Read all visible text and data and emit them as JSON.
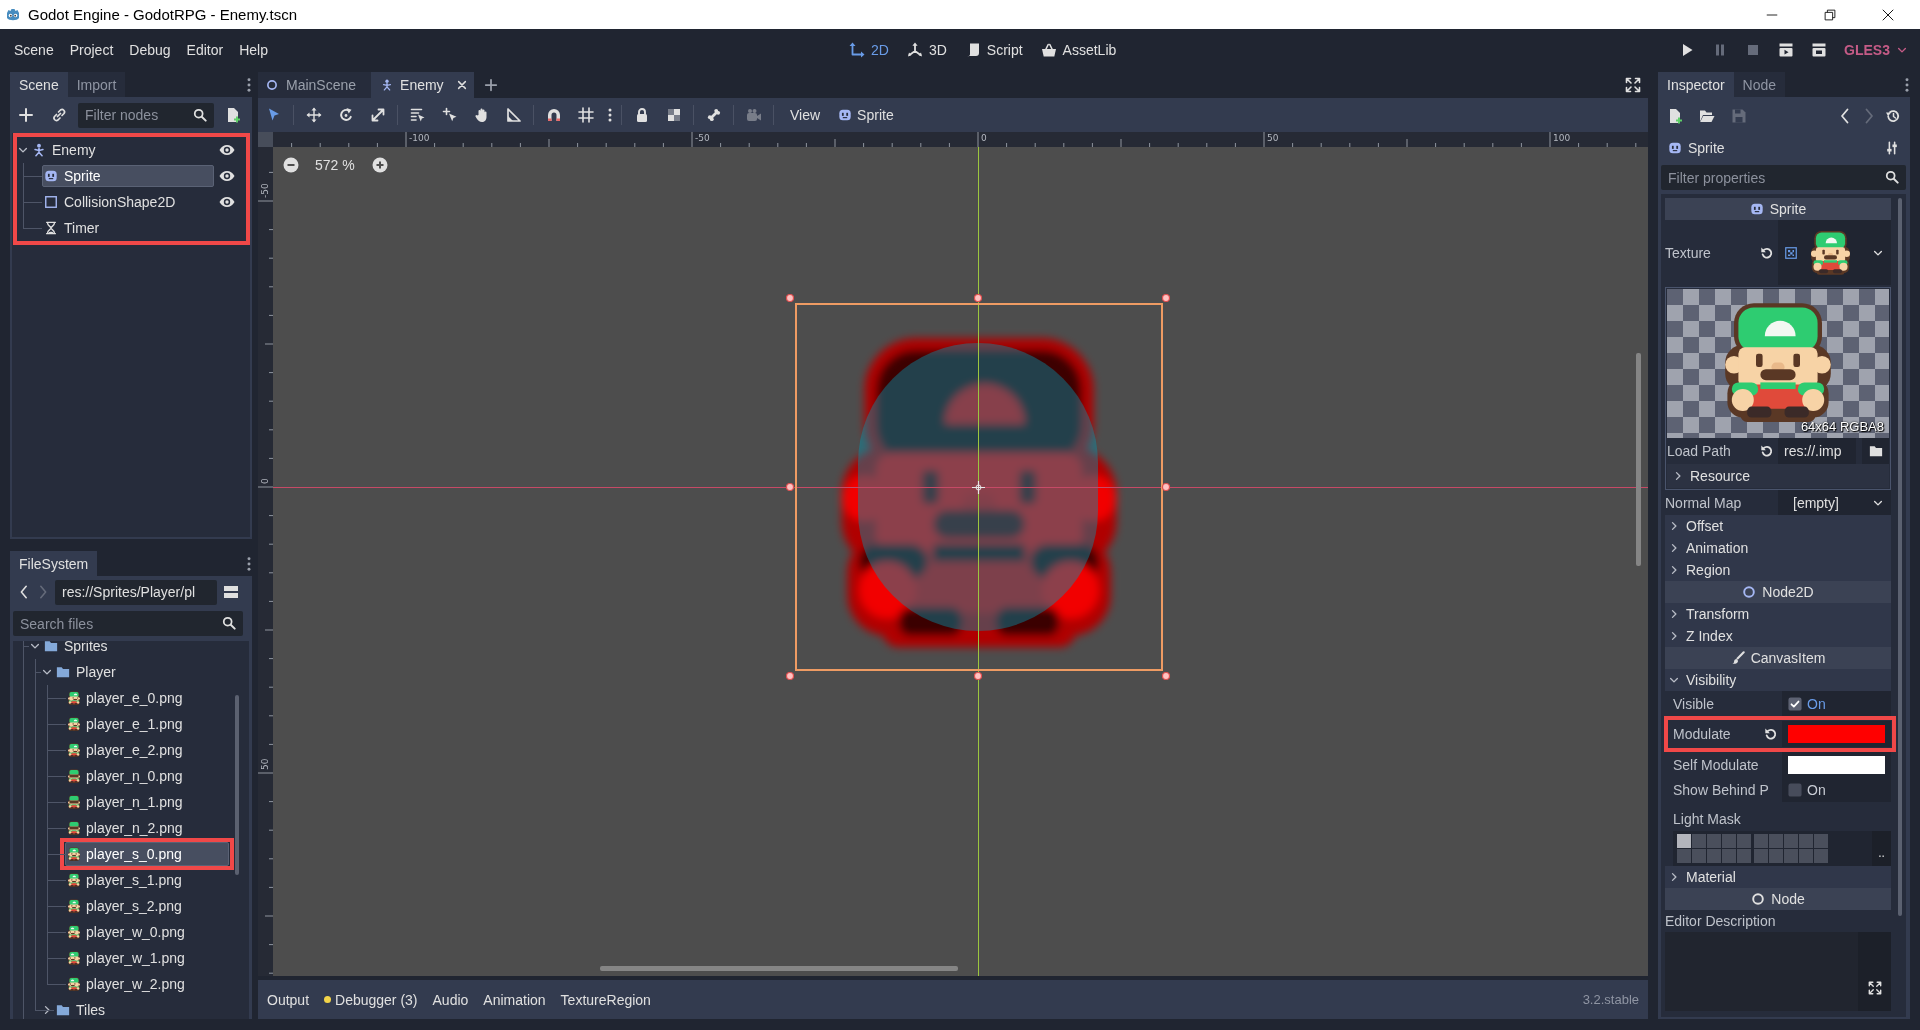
{
  "window": {
    "title": "Godot Engine - GodotRPG - Enemy.tscn"
  },
  "menu_bar": {
    "menus": [
      "Scene",
      "Project",
      "Debug",
      "Editor",
      "Help"
    ],
    "workspaces": [
      {
        "label": "2D",
        "kind": "canvas",
        "selected": true
      },
      {
        "label": "3D",
        "kind": "spatial",
        "selected": false
      },
      {
        "label": "Script",
        "kind": "script",
        "selected": false
      },
      {
        "label": "AssetLib",
        "kind": "assetlib",
        "selected": false
      }
    ],
    "run_buttons": [
      {
        "kind": "play",
        "disabled": false
      },
      {
        "kind": "pause",
        "disabled": true
      },
      {
        "kind": "stop",
        "disabled": true
      },
      {
        "kind": "play_scene",
        "disabled": false
      },
      {
        "kind": "play_custom",
        "disabled": false
      }
    ],
    "renderer": "GLES3"
  },
  "scene_dock": {
    "tabs": [
      {
        "label": "Scene",
        "selected": true
      },
      {
        "label": "Import",
        "selected": false
      }
    ],
    "filter": {
      "placeholder": "Filter nodes"
    },
    "highlighted": true,
    "tree": [
      {
        "name": "Enemy",
        "kind": "kinematic_body",
        "expanded": true,
        "selected": false,
        "visibility_toggle": true,
        "children": [
          {
            "name": "Sprite",
            "kind": "sprite",
            "selected": true,
            "visibility_toggle": true
          },
          {
            "name": "CollisionShape2D",
            "kind": "collision_shape",
            "selected": false,
            "visibility_toggle": true
          },
          {
            "name": "Timer",
            "kind": "timer",
            "selected": false,
            "visibility_toggle": false
          }
        ]
      }
    ]
  },
  "filesystem_dock": {
    "tabs": [
      {
        "label": "FileSystem",
        "selected": true
      }
    ],
    "nav": [
      {
        "kind": "back",
        "disabled": false
      },
      {
        "kind": "forward",
        "disabled": true
      }
    ],
    "path": "res://Sprites/Player/pl",
    "search": {
      "placeholder": "Search files"
    },
    "tree": [
      {
        "name": "Sprites",
        "kind": "folder",
        "expanded": true,
        "selected": false,
        "highlighted": false,
        "children": [
          {
            "name": "Player",
            "kind": "folder",
            "expanded": true,
            "selected": false,
            "highlighted": false,
            "children": [
              {
                "name": "player_e_0.png",
                "kind": "east",
                "selected": false,
                "highlighted": false
              },
              {
                "name": "player_e_1.png",
                "kind": "east",
                "selected": false,
                "highlighted": false
              },
              {
                "name": "player_e_2.png",
                "kind": "east",
                "selected": false,
                "highlighted": false
              },
              {
                "name": "player_n_0.png",
                "kind": "north",
                "selected": false,
                "highlighted": false
              },
              {
                "name": "player_n_1.png",
                "kind": "north",
                "selected": false,
                "highlighted": false
              },
              {
                "name": "player_n_2.png",
                "kind": "north",
                "selected": false,
                "highlighted": false
              },
              {
                "name": "player_s_0.png",
                "kind": "south",
                "selected": true,
                "highlighted": true
              },
              {
                "name": "player_s_1.png",
                "kind": "south",
                "selected": false,
                "highlighted": false
              },
              {
                "name": "player_s_2.png",
                "kind": "south",
                "selected": false,
                "highlighted": false
              },
              {
                "name": "player_w_0.png",
                "kind": "west",
                "selected": false,
                "highlighted": false
              },
              {
                "name": "player_w_1.png",
                "kind": "west",
                "selected": false,
                "highlighted": false
              },
              {
                "name": "player_w_2.png",
                "kind": "west",
                "selected": false,
                "highlighted": false
              }
            ]
          },
          {
            "name": "Tiles",
            "kind": "folder",
            "expanded": false,
            "selected": false,
            "highlighted": false
          }
        ]
      }
    ]
  },
  "editor": {
    "tabs": [
      {
        "label": "MainScene",
        "kind": "node2d",
        "selected": false,
        "closable": false
      },
      {
        "label": "Enemy",
        "kind": "kinematic_body",
        "selected": true,
        "closable": true
      }
    ],
    "toolbar": {
      "tool_groups": [
        [
          {
            "kind": "select",
            "selected": true,
            "disabled": false
          }
        ],
        [
          {
            "kind": "move",
            "selected": false,
            "disabled": false
          },
          {
            "kind": "rotate",
            "selected": false,
            "disabled": false
          },
          {
            "kind": "scale",
            "selected": false,
            "disabled": false
          }
        ],
        [
          {
            "kind": "list_select",
            "selected": false,
            "disabled": false
          },
          {
            "kind": "pivot",
            "selected": false,
            "disabled": false
          },
          {
            "kind": "pan",
            "selected": false,
            "disabled": false
          },
          {
            "kind": "ruler",
            "selected": false,
            "disabled": false
          }
        ],
        [
          {
            "kind": "smart_snap",
            "selected": false,
            "disabled": false
          },
          {
            "kind": "grid_snap",
            "selected": false,
            "disabled": false
          },
          {
            "kind": "more",
            "selected": false,
            "disabled": false
          }
        ],
        [
          {
            "kind": "lock",
            "selected": false,
            "disabled": false
          },
          {
            "kind": "group",
            "selected": false,
            "disabled": false
          }
        ],
        [
          {
            "kind": "bone",
            "selected": false,
            "disabled": false
          }
        ],
        [
          {
            "kind": "camera",
            "selected": false,
            "disabled": true
          }
        ]
      ],
      "menus": [
        {
          "label": "View",
          "kind": "plain"
        },
        {
          "label": "Sprite",
          "kind": "sprite"
        }
      ]
    },
    "zoom": "572 %",
    "rulers": {
      "horizontal": [
        "-100",
        "-50",
        "0",
        "50",
        "100"
      ],
      "vertical": [
        "-50",
        "0",
        "50"
      ]
    }
  },
  "bottom_panel": {
    "tabs": [
      {
        "label": "Output",
        "warning": false
      },
      {
        "label": "Debugger (3)",
        "warning": true
      },
      {
        "label": "Audio",
        "warning": false
      },
      {
        "label": "Animation",
        "warning": false
      },
      {
        "label": "TextureRegion",
        "warning": false
      }
    ],
    "version": "3.2.stable"
  },
  "inspector": {
    "tabs": [
      {
        "label": "Inspector",
        "selected": true
      },
      {
        "label": "Node",
        "selected": false
      }
    ],
    "toolbar": {
      "left": [
        {
          "kind": "new_resource",
          "disabled": false
        },
        {
          "kind": "open",
          "disabled": false
        },
        {
          "kind": "save",
          "disabled": true
        }
      ],
      "right": [
        {
          "kind": "back",
          "disabled": false
        },
        {
          "kind": "forward",
          "disabled": true
        },
        {
          "kind": "history",
          "disabled": false
        }
      ]
    },
    "object": {
      "name": "Sprite",
      "kind": "sprite"
    },
    "filter": {
      "placeholder": "Filter properties"
    },
    "items": [
      {
        "kind": "category",
        "label": "Sprite"
      },
      {
        "kind": "texture",
        "label": "Texture",
        "revertable": true,
        "highlighted": false,
        "info": "64x64 RGBA8",
        "load_path": {
          "label": "Load Path",
          "value": "res://.imp",
          "revertable": true
        },
        "subgroup": {
          "label": "Resource",
          "expanded": false
        }
      },
      {
        "kind": "resource",
        "label": "Normal Map",
        "value": "[empty]",
        "revertable": false,
        "highlighted": false
      },
      {
        "kind": "group",
        "label": "Offset",
        "expanded": false
      },
      {
        "kind": "group",
        "label": "Animation",
        "expanded": false
      },
      {
        "kind": "group",
        "label": "Region",
        "expanded": false
      },
      {
        "kind": "category",
        "label": "Node2D"
      },
      {
        "kind": "group",
        "label": "Transform",
        "expanded": false
      },
      {
        "kind": "group",
        "label": "Z Index",
        "expanded": false
      },
      {
        "kind": "category",
        "label": "CanvasItem"
      },
      {
        "kind": "group",
        "label": "Visibility",
        "expanded": true,
        "children": [
          {
            "kind": "check",
            "label": "Visible",
            "checked": true,
            "value": "On",
            "revertable": false,
            "highlighted": false
          },
          {
            "kind": "color",
            "label": "Modulate",
            "color": "#ff0000",
            "revertable": true,
            "highlighted": true
          },
          {
            "kind": "color",
            "label": "Self Modulate",
            "color": "#ffffff",
            "revertable": false,
            "highlighted": false
          },
          {
            "kind": "check",
            "label": "Show Behind P",
            "checked": false,
            "value": "On",
            "revertable": false,
            "highlighted": false
          },
          {
            "kind": "layers",
            "label": "Light Mask",
            "more": "..",
            "revertable": false,
            "highlighted": false,
            "bits": [
              {
                "on": true
              },
              {
                "on": false
              },
              {
                "on": false
              },
              {
                "on": false
              },
              {
                "on": false
              },
              {
                "on": false
              },
              {
                "on": false
              },
              {
                "on": false
              },
              {
                "on": false
              },
              {
                "on": false
              },
              {
                "on": false
              },
              {
                "on": false
              },
              {
                "on": false
              },
              {
                "on": false
              },
              {
                "on": false
              },
              {
                "on": false
              },
              {
                "on": false
              },
              {
                "on": false
              },
              {
                "on": false
              },
              {
                "on": false
              }
            ]
          }
        ]
      },
      {
        "kind": "group",
        "label": "Material",
        "expanded": false
      },
      {
        "kind": "category",
        "label": "Node"
      },
      {
        "kind": "text",
        "label": "Editor Description"
      }
    ]
  }
}
